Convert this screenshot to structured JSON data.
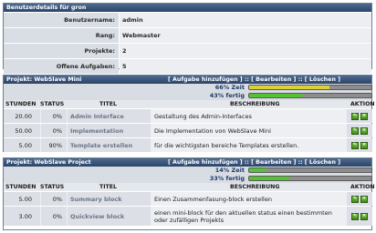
{
  "user_panel": {
    "header": "Benutzerdetails für gron",
    "rows": [
      {
        "label": "Benutzername:",
        "value": "admin"
      },
      {
        "label": "Rang:",
        "value": "Webmaster"
      },
      {
        "label": "Projekte:",
        "value": "2"
      },
      {
        "label": "Offene Aufgaben:",
        "value": "5"
      }
    ]
  },
  "columns": {
    "hours": "STUNDEN",
    "status": "STATUS",
    "title": "TITEL",
    "desc": "BESCHREIBUNG",
    "action": "AKTION"
  },
  "projects": [
    {
      "header": "Projekt: WebSlave Mini",
      "links": {
        "add": "[ Aufgabe hinzufügen ]",
        "sep1": " :: ",
        "edit": "[ Bearbeiten ]",
        "sep2": " :: ",
        "delete": "[ Löschen ]"
      },
      "time_label": "66% Zeit",
      "time_fraction": 0.66,
      "time_color": "#d9d23a",
      "done_label": "43% fertig",
      "done_fraction": 0.43,
      "done_color": "#55c233",
      "tasks": [
        {
          "hours": "20.00",
          "status": "0%",
          "title": "Admin Interface",
          "desc": "Gestaltung des Admin-Interfaces"
        },
        {
          "hours": "50.00",
          "status": "0%",
          "title": "Implementation",
          "desc": "Die Implementation von WebSlave Mini"
        },
        {
          "hours": "5.00",
          "status": "90%",
          "title": "Template erstellen",
          "desc": "für die wichtigsten bereiche Templates erstellen."
        }
      ]
    },
    {
      "header": "Projekt: WebSlave Project",
      "links": {
        "add": "[ Aufgabe hinzufügen ]",
        "sep1": " :: ",
        "edit": "[ Bearbeiten ]",
        "sep2": " :: ",
        "delete": "[ Löschen ]"
      },
      "time_label": "14% Zeit",
      "time_fraction": 0.14,
      "time_color": "#55c233",
      "done_label": "33% fertig",
      "done_fraction": 0.33,
      "done_color": "#55c233",
      "tasks": [
        {
          "hours": "5.00",
          "status": "0%",
          "title": "Summary block",
          "desc": "Einen Zusammenfasung-block erstellen"
        },
        {
          "hours": "3.00",
          "status": "0%",
          "title": "Quickview block",
          "desc": "einen mini-block für den aktuellen status einen bestimmten oder zufälligen Projekts"
        }
      ]
    }
  ]
}
